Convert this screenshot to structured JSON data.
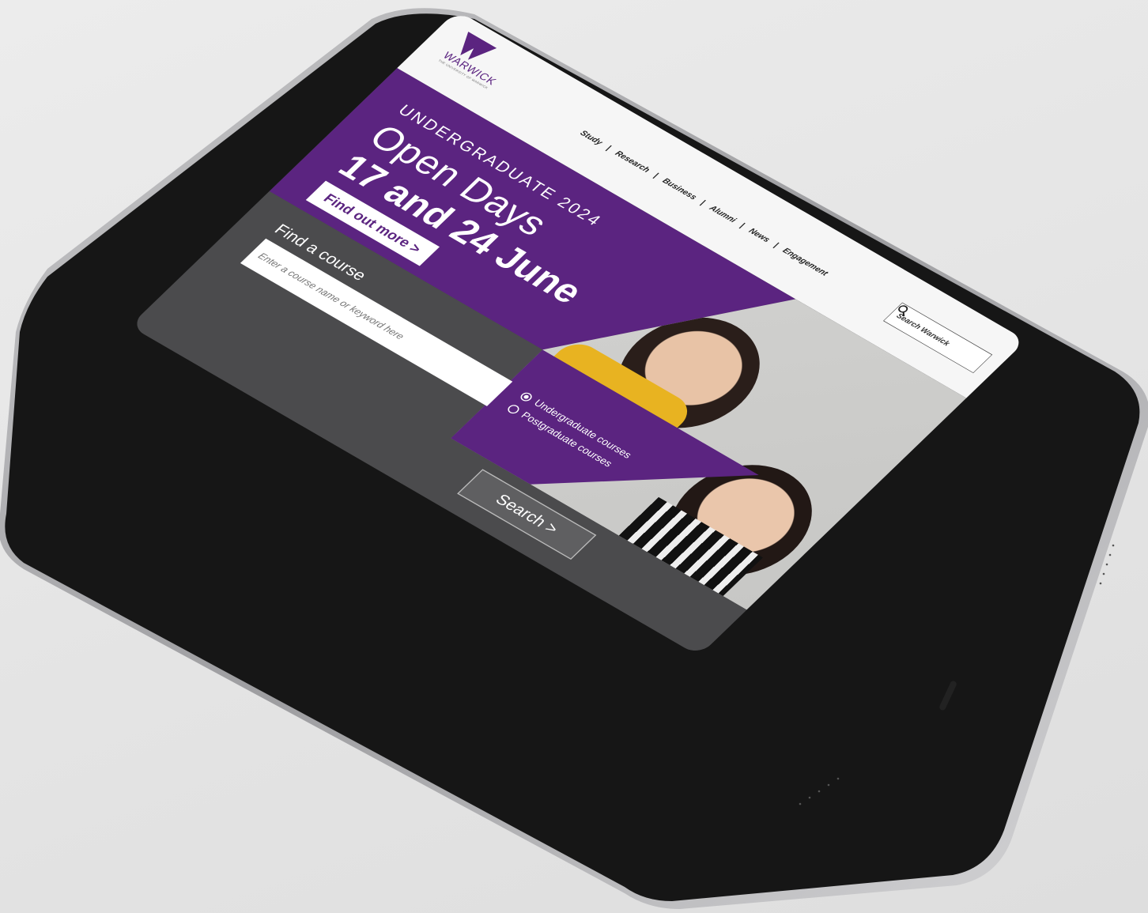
{
  "logo": {
    "wordmark": "WARWICK",
    "tagline": "THE UNIVERSITY OF WARWICK"
  },
  "nav": {
    "items": [
      "Study",
      "Research",
      "Business",
      "Alumni",
      "News",
      "Engagement"
    ],
    "separator": "|"
  },
  "top_search": {
    "placeholder": "Search Warwick",
    "icon": "search-icon"
  },
  "hero": {
    "eyebrow": "UNDERGRADUATE 2024",
    "title_line1": "Open Days",
    "title_line2": "17 and 24 June",
    "cta_label": "Find out more >"
  },
  "course_finder": {
    "title": "Find a course",
    "placeholder": "Enter a course name or keyword here",
    "options": [
      "Undergraduate courses",
      "Postgraduate courses"
    ],
    "selected": "Undergraduate courses",
    "search_label": "Search >"
  },
  "colors": {
    "brand_purple": "#5b2480",
    "band_gray": "#4b4b4d",
    "header_bg": "#f6f6f6"
  }
}
